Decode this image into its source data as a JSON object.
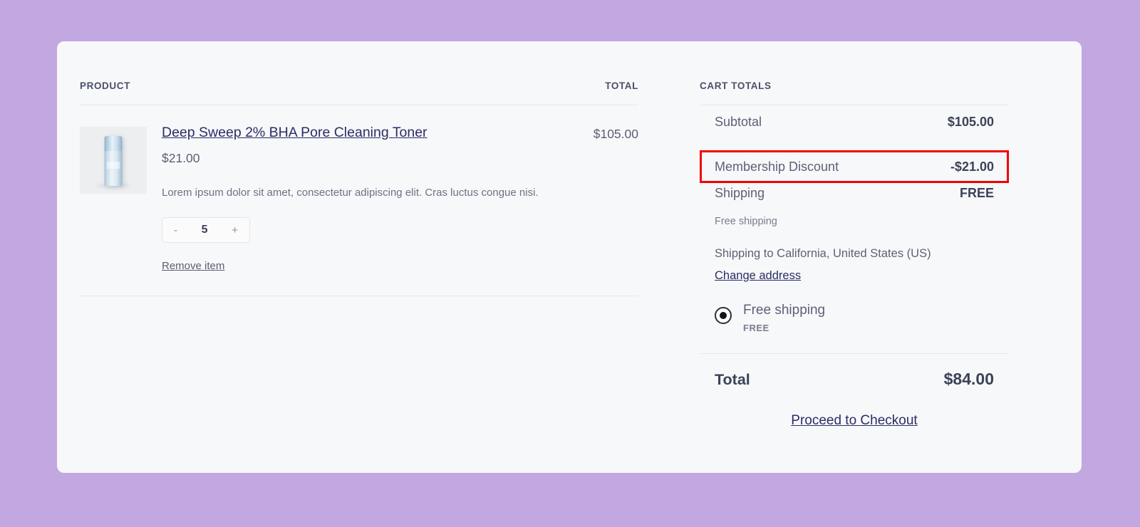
{
  "theme": {
    "page_background": "#c2a7e0",
    "card_background": "#f7f8fa",
    "highlight_border": "#f40000",
    "link_color": "#2b2d64"
  },
  "product_table": {
    "headers": {
      "product": "PRODUCT",
      "total": "TOTAL"
    },
    "items": [
      {
        "thumbnail_icon": "toner-bottle-thumbnail",
        "title": "Deep Sweep 2% BHA Pore Cleaning Toner",
        "unit_price": "$21.00",
        "description": "Lorem ipsum dolor sit amet, consectetur adipiscing elit. Cras luctus congue nisi.",
        "quantity": "5",
        "decrement_label": "-",
        "increment_label": "+",
        "remove_label": "Remove item",
        "line_total": "$105.00"
      }
    ]
  },
  "cart_totals": {
    "heading": "CART TOTALS",
    "subtotal": {
      "label": "Subtotal",
      "value": "$105.00"
    },
    "discount": {
      "label": "Membership Discount",
      "value": "-$21.00",
      "highlighted": true
    },
    "shipping": {
      "label": "Shipping",
      "value": "FREE",
      "note": "Free shipping",
      "destination": "Shipping to California, United States (US)",
      "change_address_label": "Change address",
      "methods": [
        {
          "name": "Free shipping",
          "cost": "FREE",
          "selected": true
        }
      ]
    },
    "total": {
      "label": "Total",
      "value": "$84.00"
    },
    "checkout_label": "Proceed to Checkout"
  }
}
